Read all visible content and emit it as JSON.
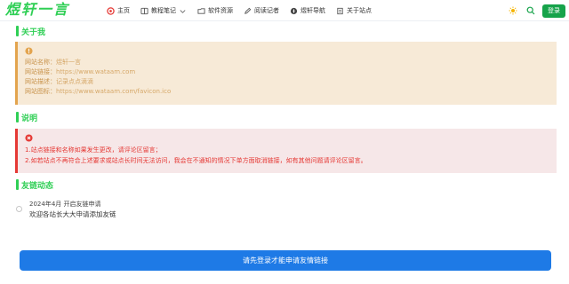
{
  "header": {
    "logo": "煜轩一言",
    "nav": [
      {
        "label": "主页",
        "icon": "home-icon"
      },
      {
        "label": "教程笔记",
        "icon": "book-icon"
      },
      {
        "label": "软件资源",
        "icon": "folder-icon"
      },
      {
        "label": "阅读记者",
        "icon": "pen-icon"
      },
      {
        "label": "煜轩导航",
        "icon": "compass-icon"
      },
      {
        "label": "关于站点",
        "icon": "info-icon"
      }
    ],
    "login": "登录"
  },
  "about": {
    "title": "关于我",
    "lines": [
      {
        "label": "网站名称：",
        "value": "煜轩一言"
      },
      {
        "label": "网站链接：",
        "value": "https://www.wataam.com"
      },
      {
        "label": "网站描述：",
        "value": "记录点点滴滴"
      },
      {
        "label": "网站图标：",
        "value": "https://www.wataam.com/favicon.ico"
      }
    ]
  },
  "notice": {
    "title": "说明",
    "lines": [
      "1.站点链接和名称如果发生更改，请评论区留言；",
      "2.如若站点不再符合上述要求或站点长时间无法访问，我会在不通知的情况下单方面取消链接，如有其他问题请评论区留言。"
    ]
  },
  "dynamics": {
    "title": "友链动态",
    "items": [
      {
        "date": "2024年4月 开启友链申请",
        "text": "欢迎各站长大大申请添加友链"
      }
    ]
  },
  "apply_button": "请先登录才能申请友情链接",
  "colors": {
    "accent": "#2fcf55",
    "warn": "#e3a44e",
    "danger": "#e53935",
    "primary": "#1e7ae6"
  }
}
